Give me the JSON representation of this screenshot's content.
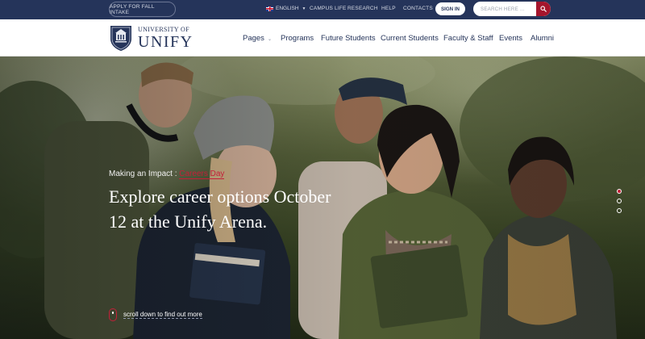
{
  "topbar": {
    "apply_label": "APPLY FOR FALL INTAKE",
    "language_label": "ENGLISH",
    "links": [
      {
        "label": "CAMPUS LIFE"
      },
      {
        "label": "RESEARCH"
      },
      {
        "label": "HELP"
      },
      {
        "label": "CONTACTS"
      }
    ],
    "signin_label": "SIGN IN",
    "search_placeholder": "SEARCH HERE ...",
    "accent_color": "#a5152d"
  },
  "brand": {
    "small": "UNIVERSITY OF",
    "big": "UNIFY",
    "color": "#25345a"
  },
  "nav": {
    "items": [
      {
        "label": "Pages"
      },
      {
        "label": "Programs"
      },
      {
        "label": "Future Students"
      },
      {
        "label": "Current Students"
      },
      {
        "label": "Faculty & Staff"
      },
      {
        "label": "Events"
      },
      {
        "label": "Alumni"
      }
    ]
  },
  "hero": {
    "kicker_prefix": "Making an Impact : ",
    "kicker_highlight": "Careers Day",
    "headline": "Explore career options October 12 at the Unify Arena.",
    "slides_total": 3,
    "active_slide": 1,
    "scroll_label": "scroll down to find out more"
  }
}
